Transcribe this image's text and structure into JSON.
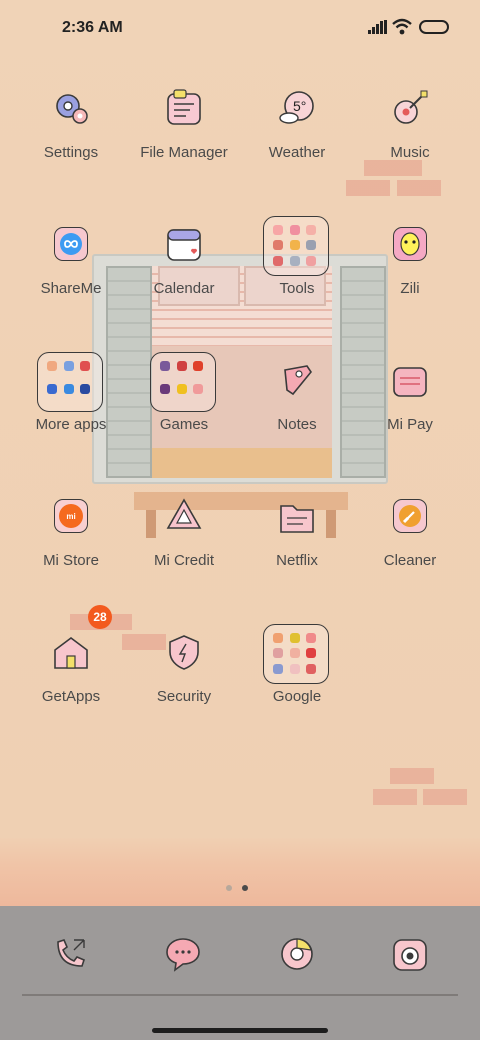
{
  "status_bar": {
    "time": "2:36 AM"
  },
  "apps": [
    {
      "label": "Settings",
      "icon": "gear-icon"
    },
    {
      "label": "File Manager",
      "icon": "notes-folder-icon"
    },
    {
      "label": "Weather",
      "icon": "weather-icon",
      "temp": "5°"
    },
    {
      "label": "Music",
      "icon": "guitar-icon"
    },
    {
      "label": "ShareMe",
      "icon": "infinity-icon"
    },
    {
      "label": "Calendar",
      "icon": "calendar-icon"
    },
    {
      "label": "Tools",
      "icon": "folder-icon"
    },
    {
      "label": "Zili",
      "icon": "zili-icon"
    },
    {
      "label": "More apps",
      "icon": "folder-icon"
    },
    {
      "label": "Games",
      "icon": "folder-icon"
    },
    {
      "label": "Notes",
      "icon": "notes-icon"
    },
    {
      "label": "Mi Pay",
      "icon": "wallet-icon"
    },
    {
      "label": "Mi Store",
      "icon": "mi-store-icon",
      "glyph": "mi"
    },
    {
      "label": "Mi Credit",
      "icon": "mi-credit-icon"
    },
    {
      "label": "Netflix",
      "icon": "folder-netflix-icon"
    },
    {
      "label": "Cleaner",
      "icon": "broom-icon"
    },
    {
      "label": "GetApps",
      "icon": "house-icon",
      "badge": "28"
    },
    {
      "label": "Security",
      "icon": "shield-icon"
    },
    {
      "label": "Google",
      "icon": "folder-icon"
    }
  ],
  "pager": {
    "pages": 2,
    "current": 2
  },
  "dock": [
    {
      "icon": "phone-icon"
    },
    {
      "icon": "messages-icon"
    },
    {
      "icon": "browser-icon"
    },
    {
      "icon": "camera-icon"
    }
  ],
  "colors": {
    "wall": "#f1d3b7",
    "brick": "#e8ae98",
    "dock": "#9d9a99",
    "badge": "#f35a1e",
    "tile": "#f8cfd0"
  }
}
